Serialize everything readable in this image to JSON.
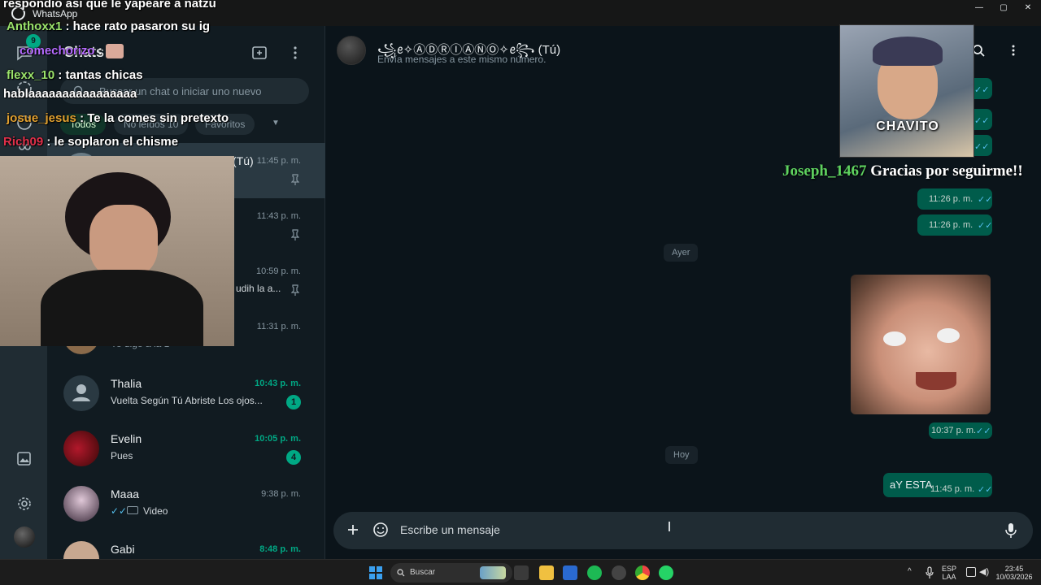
{
  "window": {
    "title": "WhatsApp"
  },
  "rail": {
    "status_badge": "9"
  },
  "sidebar": {
    "title": "Chats",
    "search_placeholder": "Buscar un chat o iniciar uno nuevo",
    "filters": [
      "Todos",
      "No leídos 10",
      "Favoritos"
    ],
    "chats": [
      {
        "name": "(Tú)",
        "time": "11:45 p. m.",
        "preview": "",
        "pinned": true,
        "selected": true
      },
      {
        "name": "",
        "time": "11:43 p. m.",
        "preview": "",
        "pinned": true
      },
      {
        "name": "",
        "time": "10:59 p. m.",
        "preview": "udih la a...",
        "pinned": true
      },
      {
        "name": "",
        "time": "11:31 p. m.",
        "preview": "Yo digo a la 1"
      },
      {
        "name": "Thalia",
        "time": "10:43 p. m.",
        "time_green": true,
        "preview": "Vuelta Según Tú Abriste Los ojos...",
        "badge": "1"
      },
      {
        "name": "Evelin",
        "time": "10:05 p. m.",
        "time_green": true,
        "preview": "Pues",
        "badge": "4"
      },
      {
        "name": "Maaa",
        "time": "9:38 p. m.",
        "preview": "Video"
      },
      {
        "name": "Gabi",
        "time": "8:48 p. m.",
        "time_green": true,
        "preview": ""
      }
    ]
  },
  "header": {
    "name": "꧁ꫀ✧ⒶⒹⓇⒾⒶⓃⓄ✧ꫀ꧂ (Tú)",
    "subtitle": "Envía mensajes a este mismo número."
  },
  "messages": {
    "bubble_times": [
      "11:26 p. m.",
      "11:26 p. m."
    ],
    "day_yesterday": "Ayer",
    "image_time": "10:37 p. m.",
    "day_today": "Hoy",
    "last_text": "aY ESTA",
    "last_time": "11:45 p. m."
  },
  "composer": {
    "placeholder": "Escribe un mensaje"
  },
  "overlay": {
    "lines": [
      {
        "user": "",
        "text": "respondio asi que le yapeare a natzu",
        "color": "#ffffff"
      },
      {
        "user": "Anthoxx1",
        "text": ": hace rato pasaron su ig",
        "color": "#9be36b"
      },
      {
        "user": "comechorizo",
        "text": ":",
        "color": "#b56bff"
      },
      {
        "user": "flexx_10",
        "text": ": tantas chicas",
        "color": "#9be36b"
      },
      {
        "user": "",
        "text": "hablaaaaaaaaaaaaaaaa",
        "color": "#ffffff"
      },
      {
        "user": "josue_jesus",
        "text": ": Te la comes sin pretexto",
        "color": "#e0a030"
      },
      {
        "user": "Rich09",
        "text": ": le soplaron el chisme",
        "color": "#e0304a"
      }
    ],
    "chavito_label": "CHAVITO",
    "follower_user": "Joseph_1467",
    "follower_text": "Gracias por seguirme!!"
  },
  "taskbar": {
    "search": "Buscar",
    "lang": "ESP",
    "lang2": "LAA",
    "time": "23:45",
    "date": "10/03/2026"
  },
  "colors": {
    "accent": "#00a884",
    "bubble": "#005c4b",
    "tick": "#53bdeb"
  }
}
